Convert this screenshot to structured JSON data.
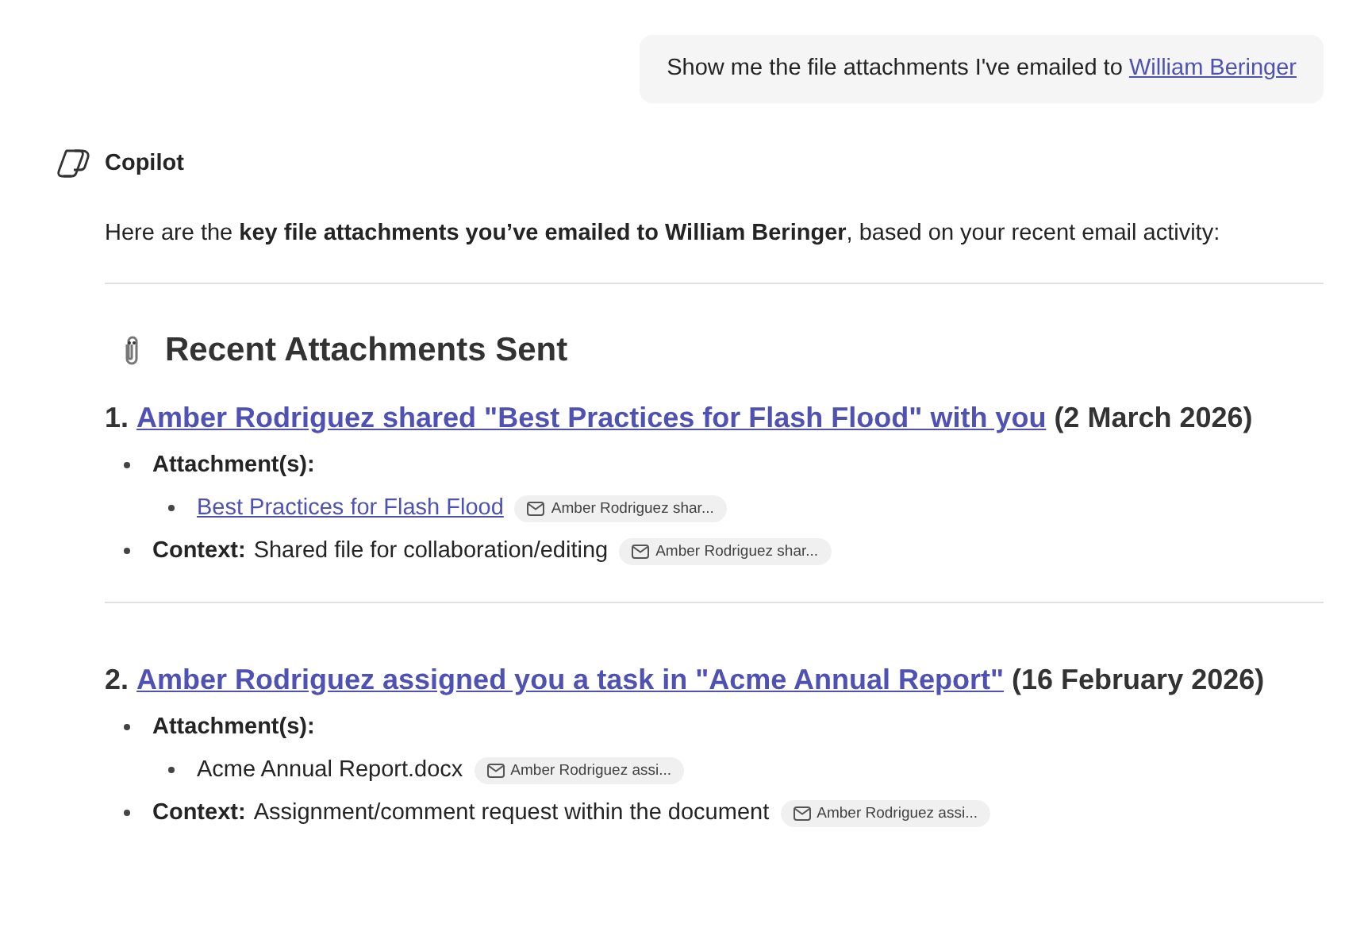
{
  "user_message": {
    "text": "Show me the file attachments I've emailed to",
    "link": "William Beringer"
  },
  "assistant": {
    "name": "Copilot",
    "intro": "Here are the **key file attachments you’ve emailed to William Beringer**, based on your recent email activity:"
  },
  "section": {
    "title": "Recent Attachments Sent"
  },
  "items": [
    {
      "number": "1.",
      "link": "Amber Rodriguez shared \"Best Practices for Flash Flood\" with you",
      "date": "(2 March 2026)",
      "attachments_label": "Attachment(s):",
      "attachments": [
        {
          "kind": "link",
          "name": "Best Practices for Flash Flood",
          "chip": "Amber Rodriguez shar..."
        }
      ],
      "context_label": "Context:",
      "context": "Shared file for collaboration/editing",
      "context_chip": "Amber Rodriguez shar..."
    },
    {
      "number": "2.",
      "link": "Amber Rodriguez assigned you a task in \"Acme Annual Report\"",
      "date": "(16 February 2026)",
      "attachments_label": "Attachment(s):",
      "attachments": [
        {
          "kind": "file",
          "name": "Acme Annual Report.docx",
          "chip": "Amber Rodriguez assi..."
        }
      ],
      "context_label": "Context:",
      "context": "Assignment/comment request within the document",
      "context_chip": "Amber Rodriguez assi..."
    }
  ]
}
